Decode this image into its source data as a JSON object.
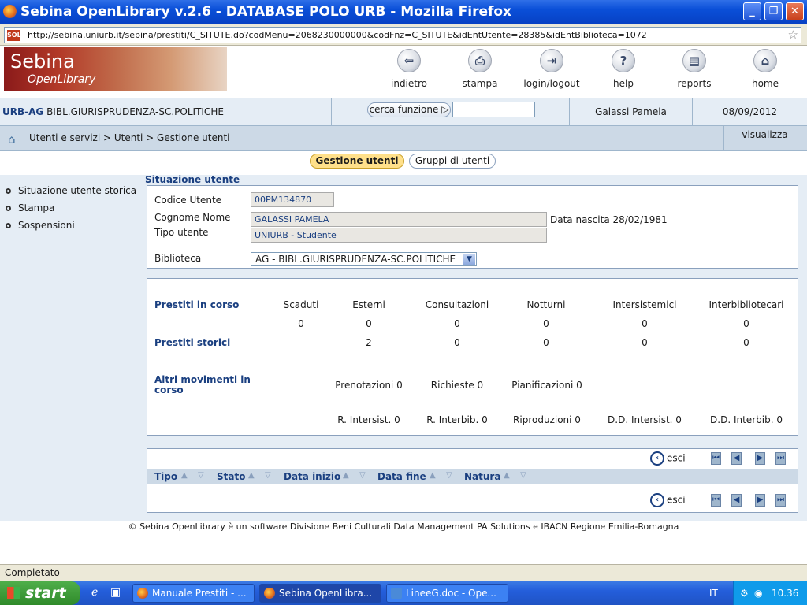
{
  "window": {
    "title": "Sebina OpenLibrary v.2.6 - DATABASE POLO URB - Mozilla Firefox",
    "min": "_",
    "max": "❐",
    "close": "✕"
  },
  "address": {
    "url": "http://sebina.uniurb.it/sebina/prestiti/C_SITUTE.do?codMenu=2068230000000&codFnz=C_SITUTE&idEntUtente=28385&idEntBiblioteca=1072",
    "site_badge": "SOL"
  },
  "logo": {
    "line1": "Sebina",
    "line2": "OpenLibrary"
  },
  "toolbar": [
    {
      "label": "indietro",
      "icon": "⇦"
    },
    {
      "label": "stampa",
      "icon": "⎙"
    },
    {
      "label": "login/logout",
      "icon": "⇥"
    },
    {
      "label": "help",
      "icon": "?"
    },
    {
      "label": "reports",
      "icon": "▤"
    },
    {
      "label": "home",
      "icon": "⌂"
    }
  ],
  "context": {
    "lib_code": "URB-AG",
    "lib_name": "BIBL.GIURISPRUDENZA-SC.POLITICHE",
    "cerca_label": "cerca funzione",
    "cerca_value": "",
    "user": "Galassi Pamela",
    "date": "08/09/2012"
  },
  "breadcrumb": {
    "text": "Utenti e servizi  >  Utenti  >  Gestione utenti",
    "visualizza": "visualizza"
  },
  "tabs": [
    {
      "label": "Gestione utenti"
    },
    {
      "label": "Gruppi di utenti"
    }
  ],
  "sidebar": [
    {
      "label": "Situazione utente storica"
    },
    {
      "label": "Stampa"
    },
    {
      "label": "Sospensioni"
    }
  ],
  "user_panel": {
    "title": "Situazione utente",
    "codice_label": "Codice Utente",
    "codice_value": "00PM134870",
    "nome_label": "Cognome Nome",
    "nome_value": "GALASSI PAMELA",
    "nascita": "Data nascita 28/02/1981",
    "tipo_label": "Tipo utente",
    "tipo_value": "UNIURB - Studente",
    "biblioteca_label": "Biblioteca",
    "biblioteca_value": "AG - BIBL.GIURISPRUDENZA-SC.POLITICHE"
  },
  "loans": {
    "in_corso_label": "Prestiti in corso",
    "storici_label": "Prestiti storici",
    "headers": [
      "Scaduti",
      "Esterni",
      "Consultazioni",
      "Notturni",
      "Intersistemici",
      "Interbibliotecari"
    ],
    "in_corso": [
      "0",
      "0",
      "0",
      "0",
      "0",
      "0"
    ],
    "storici": [
      "",
      "2",
      "0",
      "0",
      "0",
      "0"
    ],
    "altri_label": "Altri movimenti in corso",
    "altri_row1": [
      "Prenotazioni 0",
      "Richieste 0",
      "Pianificazioni 0"
    ],
    "altri_row2": [
      "R. Intersist. 0",
      "R. Interbib. 0",
      "Riproduzioni 0",
      "D.D. Intersist. 0",
      "D.D. Interbib. 0"
    ]
  },
  "list": {
    "esci": "esci",
    "columns": [
      "Tipo",
      "Stato",
      "Data inizio",
      "Data fine",
      "Natura"
    ],
    "sort_up": "▲",
    "sort_down": "▽",
    "pager": [
      "⏮",
      "◀",
      "▶",
      "⏭"
    ]
  },
  "footer": "© Sebina OpenLibrary è un software   Divisione Beni Culturali Data Management PA Solutions e  IBACN Regione Emilia-Romagna",
  "status": "Completato",
  "taskbar": {
    "start": "start",
    "tasks": [
      {
        "label": "Manuale Prestiti - ..."
      },
      {
        "label": "Sebina OpenLibra..."
      },
      {
        "label": "LineeG.doc - Ope..."
      }
    ],
    "lang": "IT",
    "clock": "10.36"
  }
}
